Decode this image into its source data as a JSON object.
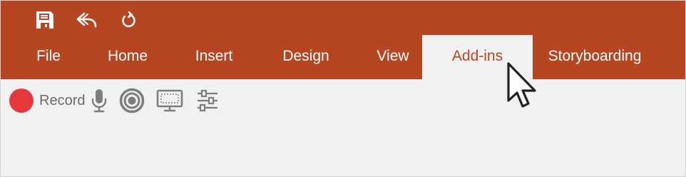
{
  "quick_access": {
    "icons": [
      "save-icon",
      "undo-icon",
      "redo-icon"
    ]
  },
  "tabs": [
    {
      "label": "File"
    },
    {
      "label": "Home"
    },
    {
      "label": "Insert"
    },
    {
      "label": "Design"
    },
    {
      "label": "View"
    },
    {
      "label": "Add-ins",
      "active": true
    },
    {
      "label": "Storyboarding"
    }
  ],
  "ribbon": {
    "record_label": "Record",
    "icons": [
      "record-icon",
      "microphone-icon",
      "camera-target-icon",
      "screen-icon",
      "sliders-icon"
    ]
  },
  "colors": {
    "title_bar": "#b64622",
    "ribbon_bg": "#f1f1f1",
    "record": "#e5383b",
    "icon_gray": "#7d7d7d"
  }
}
